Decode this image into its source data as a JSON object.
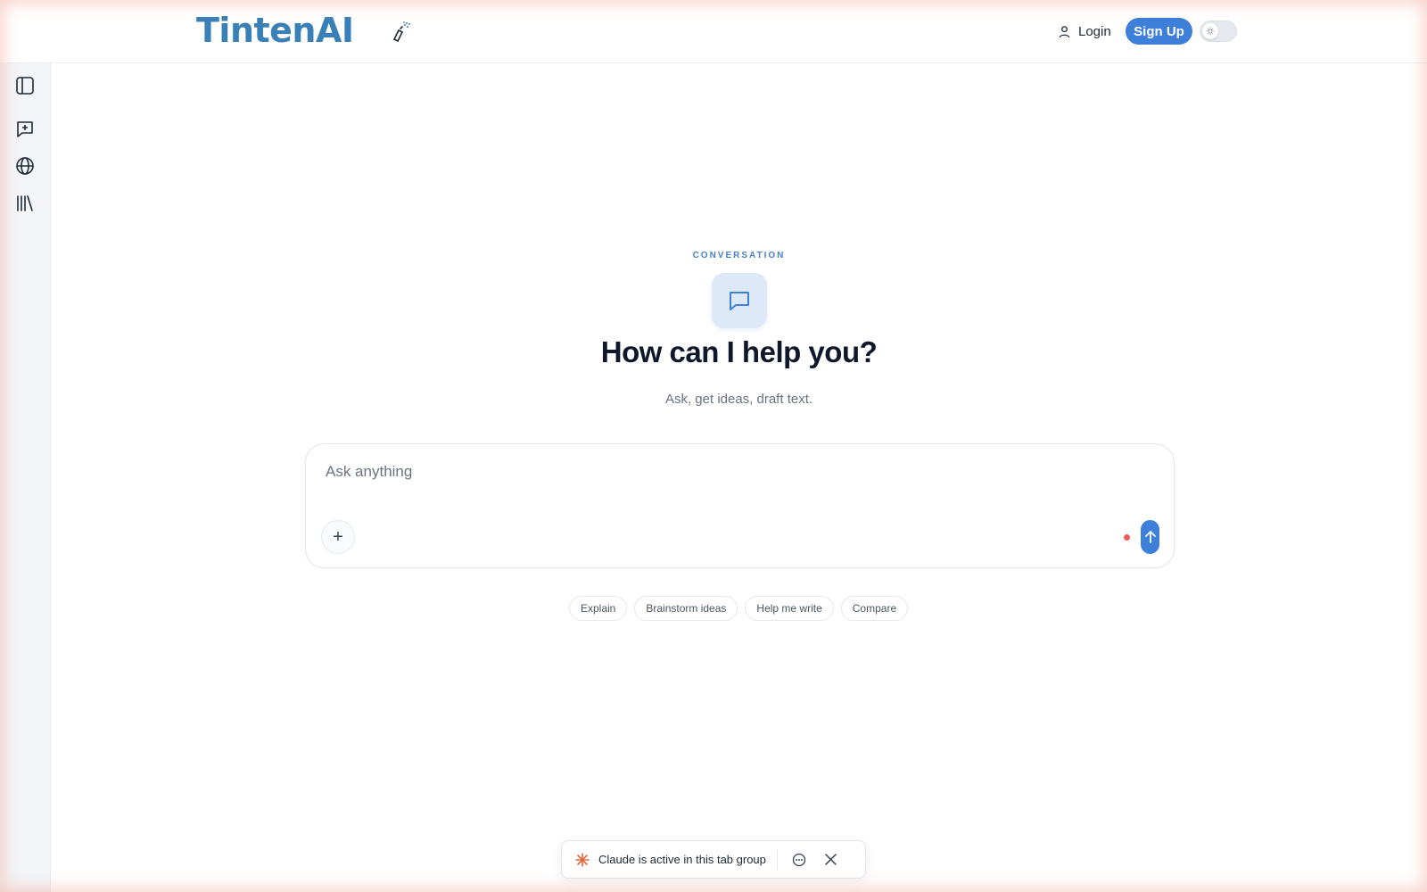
{
  "header": {
    "brand": "TintenAI",
    "login_label": "Login",
    "signup_label": "Sign Up"
  },
  "icons": {
    "brand_mark": "spray-paint-icon",
    "login": "user-icon",
    "theme": "sun-icon",
    "sidebar": [
      "sidebar-toggle-icon",
      "new-chat-icon",
      "globe-icon",
      "library-icon"
    ],
    "hero": "chat-bubble-icon",
    "toast": [
      "claude-spark-icon",
      "chat-icon",
      "close-icon"
    ]
  },
  "main": {
    "eyebrow": "CONVERSATION",
    "title": "How can I help you?",
    "subtitle": "Ask, get ideas, draft text.",
    "composer": {
      "placeholder": "Ask anything",
      "value": "",
      "attach_label": "+"
    },
    "suggestions": [
      "Explain",
      "Brainstorm ideas",
      "Help me write",
      "Compare"
    ]
  },
  "toast": {
    "text": "Claude is active in this tab group"
  },
  "colors": {
    "brand": "#3a80b8",
    "accent": "#3d7fd9",
    "recording": "#ef5b5b",
    "spark": "#e0683c"
  }
}
